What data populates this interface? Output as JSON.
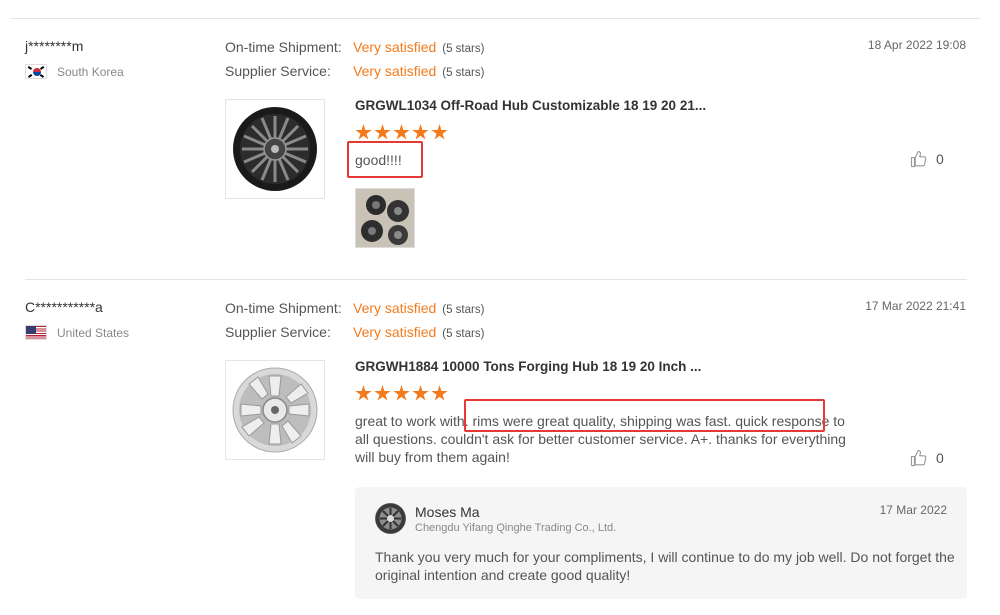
{
  "labels": {
    "ontime": "On-time Shipment:",
    "supplier": "Supplier Service:"
  },
  "reviews": [
    {
      "user": "j********m",
      "country": "South Korea",
      "flag_icon": "south-korea-flag-icon",
      "date": "18 Apr 2022 19:08",
      "ontime_value": "Very satisfied",
      "ontime_stars": "(5 stars)",
      "supplier_value": "Very satisfied",
      "supplier_stars": "(5 stars)",
      "product_title": "GRGWL1034 Off-Road Hub Customizable 18 19 20 21...",
      "rating": 5,
      "comment": "good!!!!",
      "likes": "0"
    },
    {
      "user": "C***********a",
      "country": "United States",
      "flag_icon": "united-states-flag-icon",
      "date": "17 Mar 2022 21:41",
      "ontime_value": "Very satisfied",
      "ontime_stars": "(5 stars)",
      "supplier_value": "Very satisfied",
      "supplier_stars": "(5 stars)",
      "product_title": "GRGWH1884 10000 Tons Forging Hub 18 19 20 Inch ...",
      "rating": 5,
      "comment": "great to work with. rims were great quality, shipping was fast. quick response to all questions. couldn't ask for better customer service. A+. thanks for everything will buy from them again!",
      "likes": "0",
      "reply": {
        "name": "Moses Ma",
        "company": "Chengdu Yifang Qinghe Trading Co., Ltd.",
        "date": "17 Mar 2022",
        "text": "Thank you very much for your compliments, I will continue to do my job well. Do not forget the original intention and create good quality!"
      }
    }
  ],
  "colors": {
    "accent": "#f37b1d",
    "highlight": "#e53935"
  }
}
